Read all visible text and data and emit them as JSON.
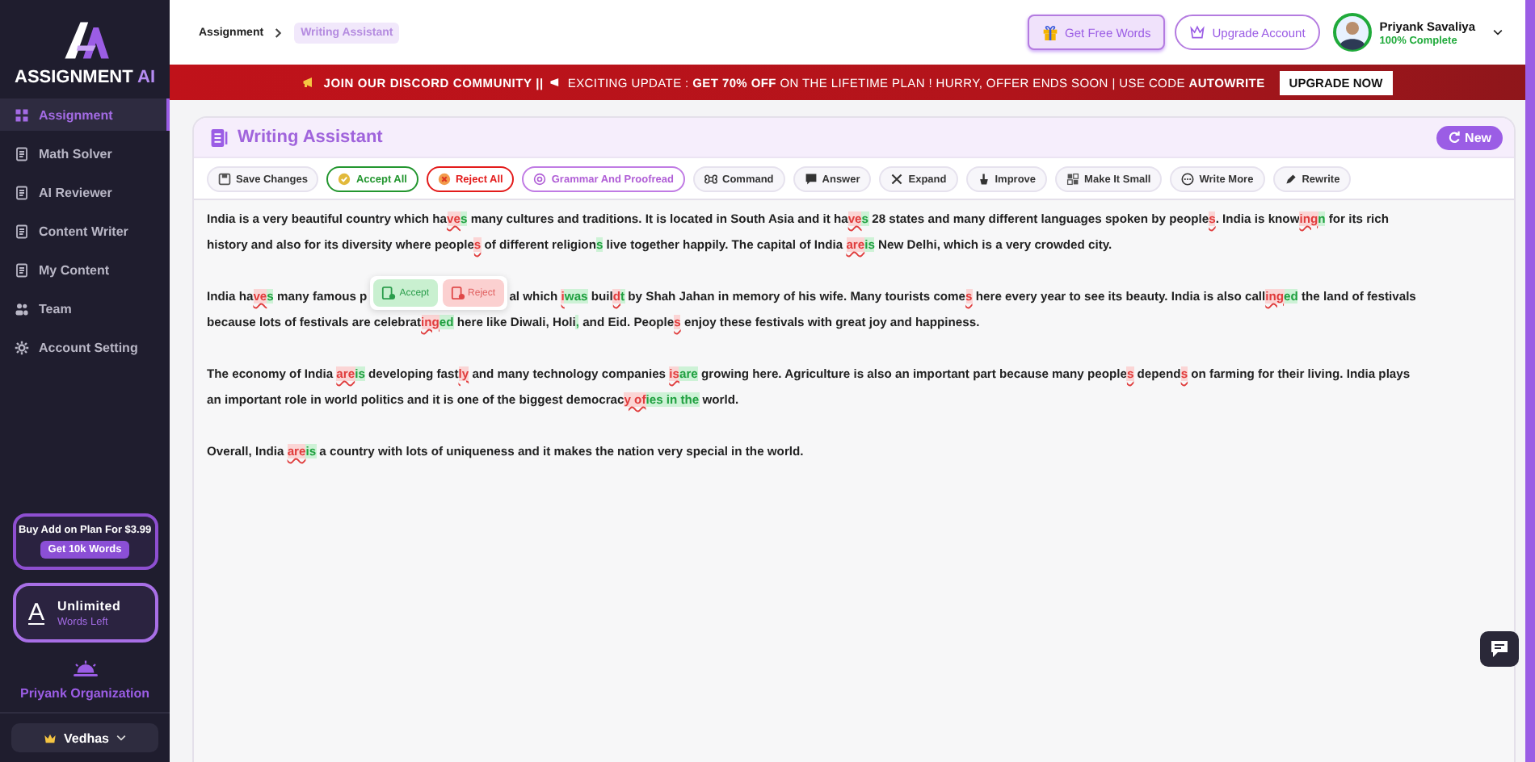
{
  "brand": {
    "name": "ASSIGNMENT",
    "accent": "AI"
  },
  "nav": [
    {
      "label": "Assignment",
      "selected": true
    },
    {
      "label": "Math Solver",
      "selected": false
    },
    {
      "label": "AI Reviewer",
      "selected": false
    },
    {
      "label": "Content Writer",
      "selected": false
    },
    {
      "label": "My Content",
      "selected": false
    },
    {
      "label": "Team",
      "selected": false
    },
    {
      "label": "Account Setting",
      "selected": false
    }
  ],
  "promo": {
    "text": "Buy Add on Plan For $3.99",
    "button": "Get 10k Words"
  },
  "plan": {
    "letter": "A",
    "title": "Unlimited",
    "subtitle": "Words Left"
  },
  "organization": "Priyank Organization",
  "workspace": "Vedhas",
  "breadcrumb": [
    {
      "label": "Assignment",
      "selected": false
    },
    {
      "label": "Writing Assistant",
      "selected": true
    }
  ],
  "header_buttons": [
    {
      "label": "Get Free Words",
      "kind": "gift"
    },
    {
      "label": "Upgrade Account",
      "kind": "crown"
    }
  ],
  "user": {
    "name": "Priyank Savaliya",
    "status": "100% Complete"
  },
  "banner": {
    "lead": "JOIN OUR DISCORD COMMUNITY ||",
    "message": "EXCITING UPDATE : **GET 70% OFF** ON THE LIFETIME PLAN ! HURRY, OFFER ENDS SOON | USE CODE **AUTOWRITE**",
    "button": "UPGRADE NOW"
  },
  "editor": {
    "title": "Writing Assistant",
    "new_button": "New",
    "tools": [
      {
        "label": "Save Changes",
        "kind": "plain",
        "selected": false
      },
      {
        "label": "Accept All",
        "kind": "accept",
        "selected": false
      },
      {
        "label": "Reject All",
        "kind": "reject",
        "selected": false
      },
      {
        "label": "Grammar And Proofread",
        "kind": "plain",
        "selected": true
      },
      {
        "label": "Command",
        "kind": "plain",
        "selected": false
      },
      {
        "label": "Answer",
        "kind": "plain",
        "selected": false
      },
      {
        "label": "Expand",
        "kind": "plain",
        "selected": false
      },
      {
        "label": "Improve",
        "kind": "plain",
        "selected": false
      },
      {
        "label": "Make It Small",
        "kind": "plain",
        "selected": false
      },
      {
        "label": "Write More",
        "kind": "plain",
        "selected": false
      },
      {
        "label": "Rewrite",
        "kind": "plain",
        "selected": false
      }
    ],
    "paragraphs": [
      {
        "lines": [
          [
            {
              "kind": "text",
              "text": "India is a very beautiful country which ha"
            },
            {
              "kind": "del",
              "text": "ve"
            },
            {
              "kind": "ins",
              "text": "s"
            },
            {
              "kind": "text",
              "text": " many cultures and traditions. It is located in South Asia and it ha"
            },
            {
              "kind": "del",
              "text": "ve"
            },
            {
              "kind": "ins",
              "text": "s"
            },
            {
              "kind": "text",
              "text": " 28 states and many different languages spoken by people"
            },
            {
              "kind": "del",
              "text": "s"
            },
            {
              "kind": "text",
              "text": ". India is know"
            },
            {
              "kind": "del",
              "text": "ing"
            },
            {
              "kind": "ins",
              "text": "n"
            },
            {
              "kind": "text",
              "text": " for its rich"
            }
          ],
          [
            {
              "kind": "text",
              "text": "history and also for its diversity where people"
            },
            {
              "kind": "del",
              "text": "s"
            },
            {
              "kind": "text",
              "text": " of different religion"
            },
            {
              "kind": "ins",
              "text": "s"
            },
            {
              "kind": "text",
              "text": " live together happily. The capital of India "
            },
            {
              "kind": "del",
              "text": "are"
            },
            {
              "kind": "ins",
              "text": "is"
            },
            {
              "kind": "text",
              "text": " New Delhi, which is a very crowded city."
            }
          ]
        ]
      },
      {
        "lines": [
          [
            {
              "kind": "text",
              "text": "India ha"
            },
            {
              "kind": "del",
              "text": "ve"
            },
            {
              "kind": "ins",
              "text": "s"
            },
            {
              "kind": "text",
              "text": " many famous p"
            },
            {
              "kind": "popup",
              "accept": "Accept",
              "reject": "Reject"
            },
            {
              "kind": "text",
              "text": "al which "
            },
            {
              "kind": "del",
              "text": "i"
            },
            {
              "kind": "ins",
              "text": "was"
            },
            {
              "kind": "text",
              "text": " buil"
            },
            {
              "kind": "del",
              "text": "d"
            },
            {
              "kind": "ins",
              "text": "t"
            },
            {
              "kind": "text",
              "text": " by Shah Jahan in memory of his wife. Many tourists come"
            },
            {
              "kind": "del",
              "text": "s"
            },
            {
              "kind": "text",
              "text": " here every year to see its beauty. India is also call"
            },
            {
              "kind": "del",
              "text": "ing"
            },
            {
              "kind": "ins",
              "text": "ed"
            },
            {
              "kind": "text",
              "text": " the land of festivals"
            }
          ],
          [
            {
              "kind": "text",
              "text": "because lots of festivals are celebrat"
            },
            {
              "kind": "del",
              "text": "ing"
            },
            {
              "kind": "ins",
              "text": "ed"
            },
            {
              "kind": "text",
              "text": " here like Diwali, Holi"
            },
            {
              "kind": "ins",
              "text": ","
            },
            {
              "kind": "text",
              "text": " and Eid. People"
            },
            {
              "kind": "del",
              "text": "s"
            },
            {
              "kind": "text",
              "text": " enjoy these festivals with great joy and happiness."
            }
          ]
        ]
      },
      {
        "lines": [
          [
            {
              "kind": "text",
              "text": "The economy of India "
            },
            {
              "kind": "del",
              "text": "are"
            },
            {
              "kind": "ins",
              "text": "is"
            },
            {
              "kind": "text",
              "text": " developing fast"
            },
            {
              "kind": "del",
              "text": "ly"
            },
            {
              "kind": "text",
              "text": " and many technology companies "
            },
            {
              "kind": "del",
              "text": "is"
            },
            {
              "kind": "ins",
              "text": "are"
            },
            {
              "kind": "text",
              "text": " growing here. Agriculture is also an important part because many people"
            },
            {
              "kind": "del",
              "text": "s"
            },
            {
              "kind": "text",
              "text": " depend"
            },
            {
              "kind": "del",
              "text": "s"
            },
            {
              "kind": "text",
              "text": " on farming for their living. India plays"
            }
          ],
          [
            {
              "kind": "text",
              "text": "an important role in world politics and it is one of the biggest democrac"
            },
            {
              "kind": "del",
              "text": "y of"
            },
            {
              "kind": "ins",
              "text": "ies in the"
            },
            {
              "kind": "text",
              "text": " world."
            }
          ]
        ]
      },
      {
        "lines": [
          [
            {
              "kind": "text",
              "text": "Overall, India "
            },
            {
              "kind": "del",
              "text": "are"
            },
            {
              "kind": "ins",
              "text": "is"
            },
            {
              "kind": "text",
              "text": " a country with lots of uniqueness and it makes the nation very special in the world."
            }
          ]
        ]
      }
    ]
  }
}
